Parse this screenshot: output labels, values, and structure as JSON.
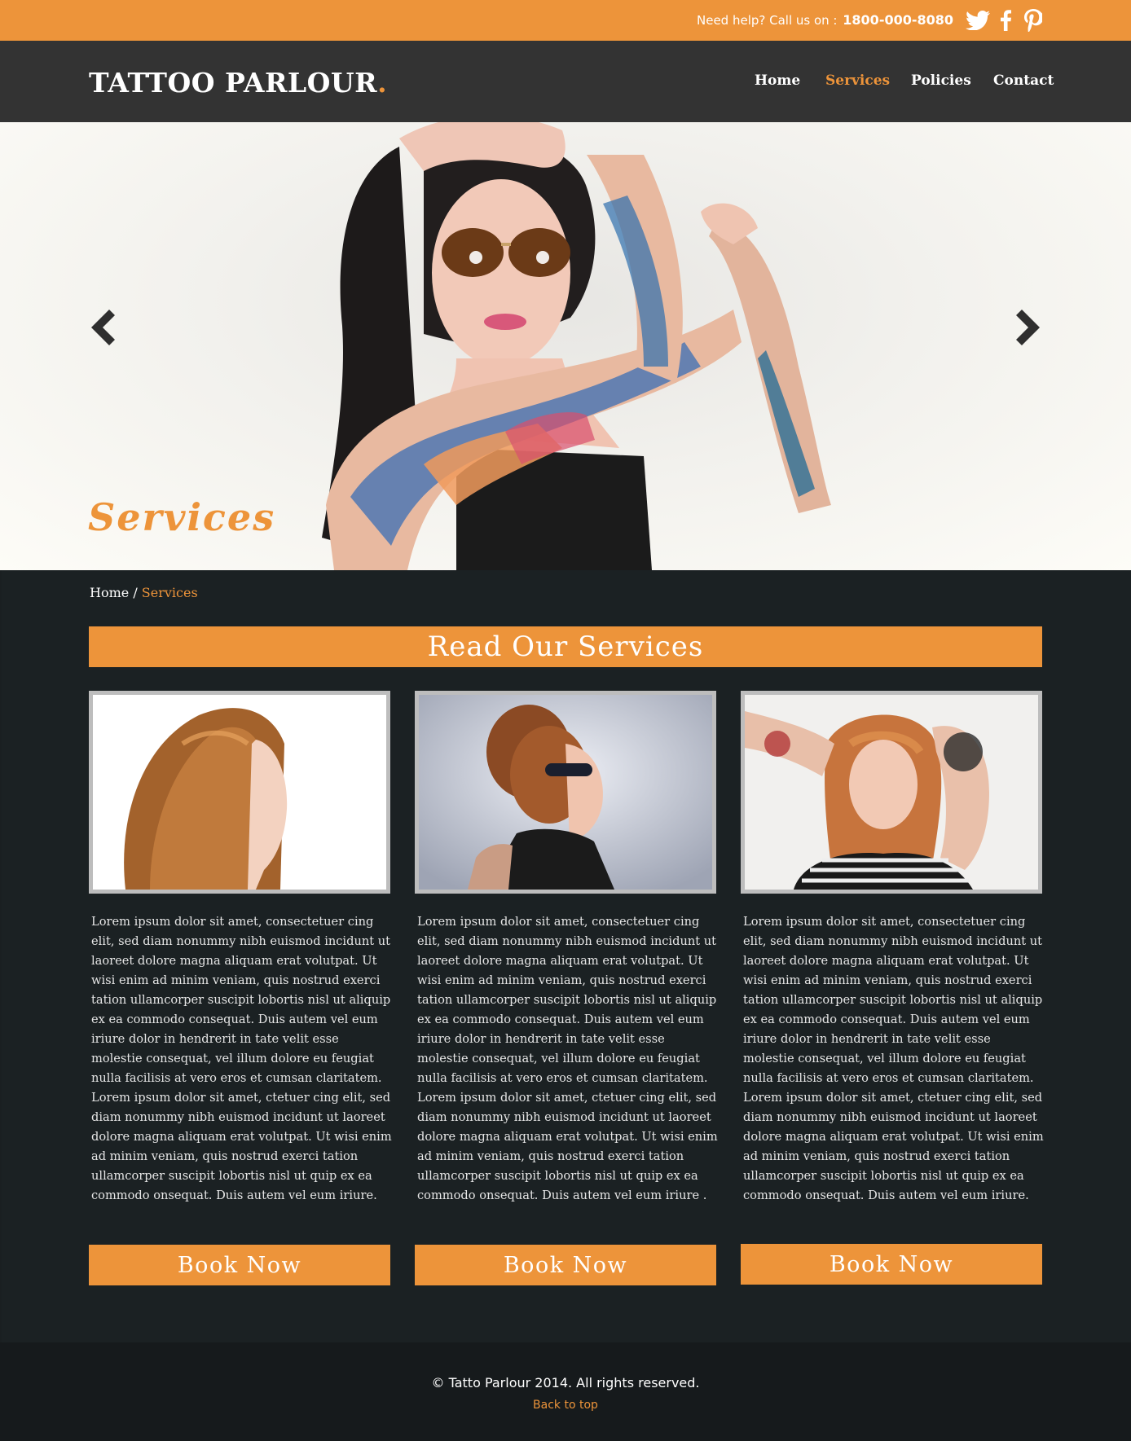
{
  "topbar": {
    "help_label": "Need help?  Call us on :",
    "phone": "1800-000-8080",
    "social_icons": [
      "twitter-icon",
      "facebook-icon",
      "pinterest-icon"
    ]
  },
  "header": {
    "logo_text": "TATTOO PARLOUR",
    "logo_dot": ".",
    "nav": [
      {
        "label": "Home",
        "active": false
      },
      {
        "label": "Services",
        "active": true
      },
      {
        "label": "Policies",
        "active": false
      },
      {
        "label": "Contact",
        "active": false
      }
    ]
  },
  "hero": {
    "title": "Services",
    "prev_icon": "chevron-left-icon",
    "next_icon": "chevron-right-icon"
  },
  "breadcrumb": {
    "home": "Home",
    "separator": " / ",
    "current": "Services"
  },
  "section": {
    "heading": "Read Our Services"
  },
  "cards": [
    {
      "text": "Lorem ipsum dolor sit amet, consectetuer cing elit, sed diam nonummy nibh euismod incidunt ut laoreet dolore magna aliquam erat volutpat. Ut wisi enim ad minim veniam, quis nostrud exerci tation ullamcorper suscipit lobortis nisl ut aliquip ex ea commodo consequat. Duis autem vel eum iriure dolor in hendrerit in tate velit esse molestie consequat, vel illum dolore eu feugiat nulla facilisis at vero eros et cumsan claritatem. Lorem ipsum dolor sit amet, ctetuer cing elit, sed diam nonummy nibh euismod incidunt ut laoreet dolore magna aliquam erat volutpat. Ut wisi enim ad minim veniam, quis nostrud exerci tation ullamcorper suscipit lobortis nisl ut quip ex ea commodo onsequat. Duis autem vel eum iriure.",
      "button": "Book Now"
    },
    {
      "text": "Lorem ipsum dolor sit amet, consectetuer cing elit, sed diam nonummy nibh euismod incidunt ut laoreet dolore magna aliquam erat volutpat. Ut wisi enim ad minim veniam, quis nostrud exerci tation ullamcorper suscipit lobortis nisl ut aliquip ex ea commodo consequat. Duis autem vel eum iriure dolor in hendrerit in tate velit esse molestie consequat, vel illum dolore eu feugiat nulla facilisis at vero eros et cumsan claritatem. Lorem ipsum dolor sit amet, ctetuer cing elit, sed diam nonummy nibh euismod incidunt ut laoreet dolore magna aliquam erat volutpat. Ut wisi enim ad minim veniam, quis nostrud exerci tation ullamcorper suscipit lobortis nisl ut quip ex ea commodo onsequat. Duis autem vel eum iriure .",
      "button": "Book Now"
    },
    {
      "text": "Lorem ipsum dolor sit amet, consectetuer cing elit, sed diam nonummy nibh euismod incidunt ut laoreet dolore magna aliquam erat volutpat. Ut wisi enim ad minim veniam, quis nostrud exerci tation ullamcorper suscipit lobortis nisl ut aliquip ex ea commodo consequat. Duis autem vel eum iriure dolor in hendrerit in tate velit esse molestie consequat, vel illum dolore eu feugiat nulla facilisis at vero eros et cumsan claritatem. Lorem ipsum dolor sit amet, ctetuer cing elit, sed diam nonummy nibh euismod incidunt ut laoreet dolore magna aliquam erat volutpat. Ut wisi enim ad minim veniam, quis nostrud exerci tation ullamcorper suscipit lobortis nisl ut quip ex ea commodo onsequat. Duis autem vel eum iriure.",
      "button": "Book Now"
    }
  ],
  "footer": {
    "copyright": "© Tatto Parlour 2014. All rights reserved.",
    "back_to_top": "Back to top"
  },
  "colors": {
    "accent": "#ed943a",
    "header": "#333333",
    "main_bg": "#1b2123",
    "footer_bg": "#161a1c"
  }
}
